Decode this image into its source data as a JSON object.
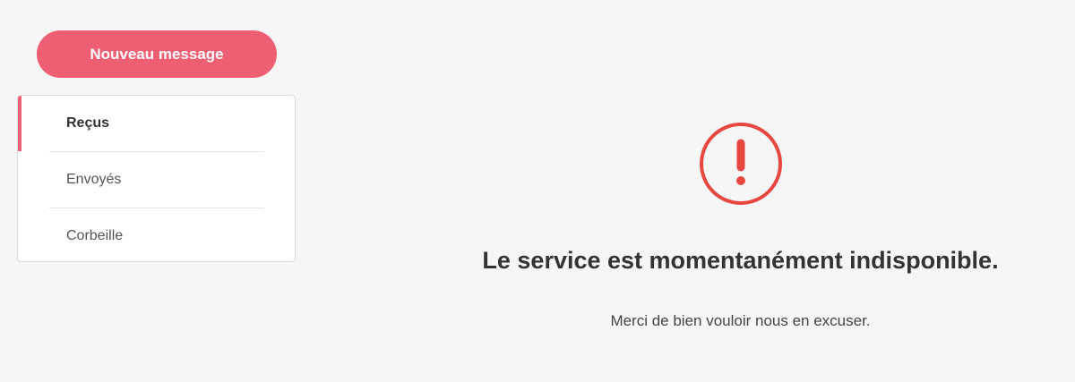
{
  "sidebar": {
    "new_message_label": "Nouveau message",
    "folders": [
      {
        "label": "Reçus",
        "active": true
      },
      {
        "label": "Envoyés",
        "active": false
      },
      {
        "label": "Corbeille",
        "active": false
      }
    ]
  },
  "error": {
    "icon": "exclamation-circle-icon",
    "title": "Le service est momentanément indisponible.",
    "subtitle": "Merci de bien vouloir nous en excuser."
  },
  "colors": {
    "accent": "#ef5f73",
    "error_icon": "#e8473f",
    "background": "#f6f6f6"
  }
}
